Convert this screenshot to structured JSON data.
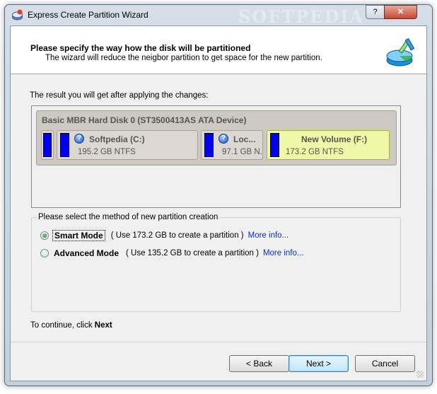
{
  "window": {
    "title": "Express Create Partition Wizard",
    "watermark": "SOFTPEDIA",
    "help_label": "?",
    "close_label": "✕"
  },
  "header": {
    "title": "Please specify the way how the disk will be partitioned",
    "subtitle": "The wizard will reduce the neigbor partition to get space for the new partition."
  },
  "result_label": "The result you will get after applying the changes:",
  "disk": {
    "title": "Basic MBR Hard Disk 0 (ST3500413AS ATA Device)",
    "partitions": [
      {
        "name": "",
        "size": "",
        "icon": ""
      },
      {
        "name": "Softpedia (C:)",
        "size": "195.2 GB NTFS",
        "icon": "question-icon"
      },
      {
        "name": "Loc...",
        "size": "97.1 GB N...",
        "icon": "question-icon"
      },
      {
        "name": "New Volume (F:)",
        "size": "173.2 GB NTFS",
        "icon": "",
        "selected": true
      }
    ]
  },
  "method": {
    "legend": "Please select the method of new partition creation",
    "options": [
      {
        "label": "Smart Mode",
        "desc": "( Use 173.2 GB to create a partition )",
        "link": "More info...",
        "checked": true
      },
      {
        "label": "Advanced Mode",
        "desc": "( Use 135.2 GB to create a partition )",
        "link": "More info...",
        "checked": false
      }
    ]
  },
  "continue": {
    "prefix": "To continue, click",
    "target": "Next"
  },
  "buttons": {
    "back": "< Back",
    "next": "Next >",
    "cancel": "Cancel"
  },
  "colors": {
    "partition_bar": "#0000ee",
    "selected_partition": "#eef8a6",
    "link": "#0033cc"
  }
}
